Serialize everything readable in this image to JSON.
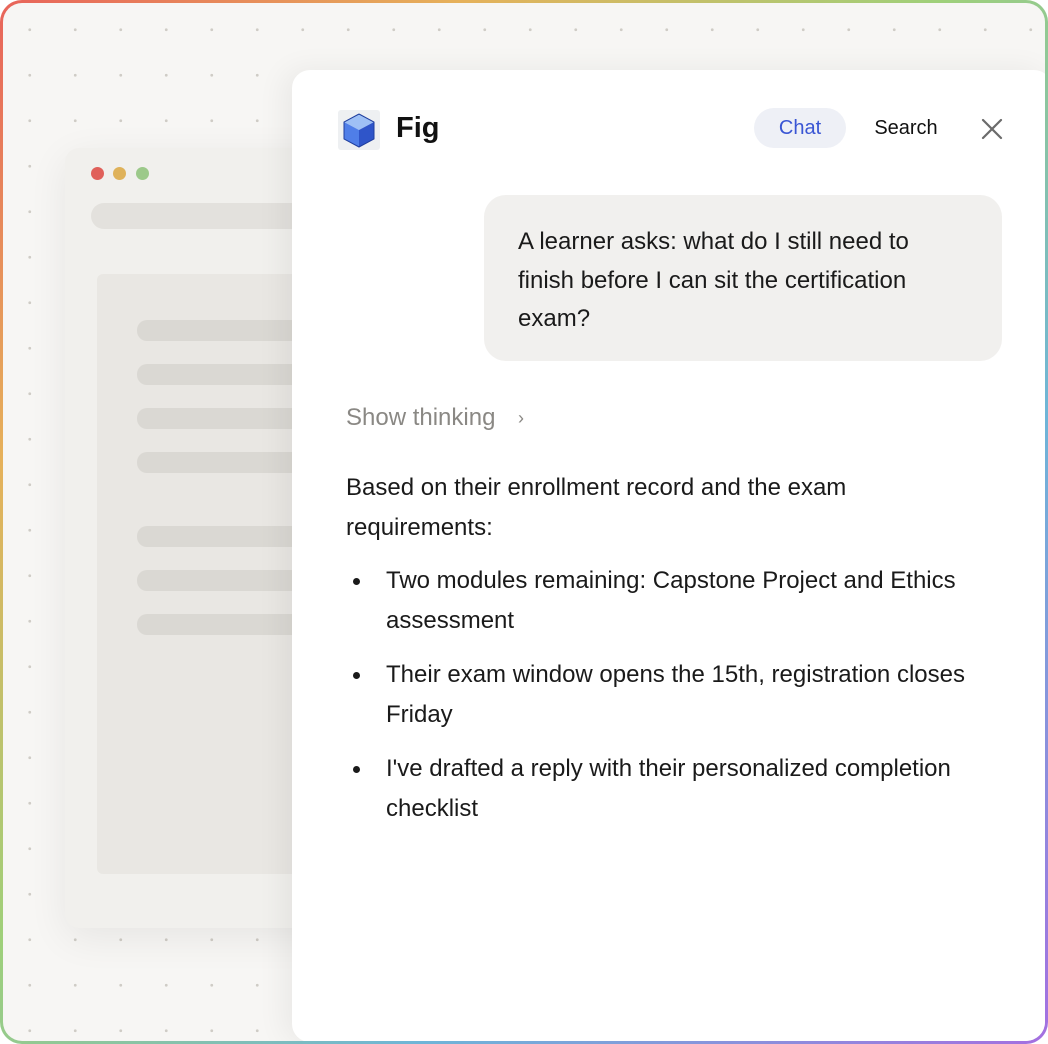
{
  "panel": {
    "app_name": "Fig",
    "tabs": [
      {
        "label": "Chat",
        "active": true
      },
      {
        "label": "Search",
        "active": false
      }
    ],
    "close_icon": "close-icon",
    "logo_icon": "cube-logo-icon"
  },
  "conversation": {
    "user_message": "A learner asks: what do I still need to finish before I can sit the certification exam?",
    "show_thinking_label": "Show thinking",
    "show_thinking_chevron": "›",
    "answer_intro": "Based on their enrollment record and the exam requirements:",
    "answer_items": [
      "Two modules remaining: Capstone Project and Ethics assessment",
      "Their exam window opens the 15th, registration closes Friday",
      "I've drafted a reply with their personalized completion checklist"
    ]
  },
  "colors": {
    "accent": "#3a56d4",
    "active_tab_bg": "#eef0f6",
    "user_bubble_bg": "#f1f0ee",
    "muted_text": "#8a8884",
    "window_dot_red": "#e0605a",
    "window_dot_yellow": "#dfb25a",
    "window_dot_green": "#9cc98a"
  }
}
